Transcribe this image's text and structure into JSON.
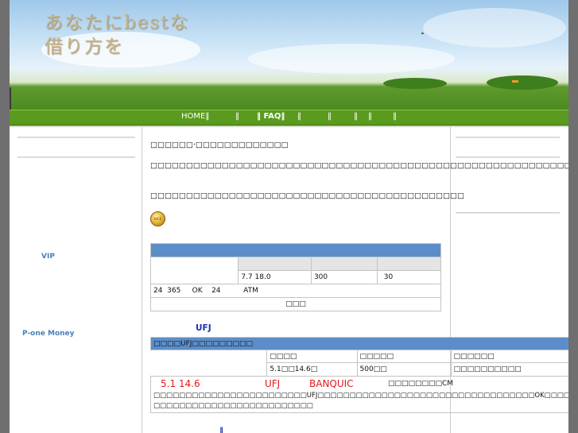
{
  "header": {
    "title": "あなたにbestな\n借り方を"
  },
  "nav": {
    "items": [
      "HOME‖",
      "‖",
      "‖ FAQ‖",
      "‖",
      "‖",
      "‖",
      "‖",
      "‖"
    ]
  },
  "left_sidebar": {
    "link_vip": "VIP",
    "link_pone": "P-one Money"
  },
  "main": {
    "intro_line": "□□□□□□·□□□□□□□□□□□□□",
    "paragraph_1": "□□□□□□□□□□□□□□□□□□□□□□□□□□□□□□□□□□□□□□□□□□□□□□□□□□□□□□□□□□□□□□□□□□□□□□",
    "paragraph_2": "□□□□□□□□□□□□□□□□□□□□□□□□□□□□□□□□□□□□□□□□□□□□",
    "coin_label": "NICE",
    "table1": {
      "rate": "7.7  18.0",
      "limit": "300",
      "days": "30",
      "note_row": "24  365     OK    24          ATM",
      "footer": "□□□"
    },
    "ufj_label": "UFJ",
    "table2": {
      "header": "□□□□UFJ□□□□□□□□□",
      "col_headers": [
        "□□□□",
        "□□□□□",
        "□□□□□□"
      ],
      "values": [
        "5.1□□14.6□",
        "500□□",
        "□□□□□□□□□□"
      ],
      "highlight": [
        "5.1  14.6",
        "UFJ",
        "BANQUIC"
      ],
      "cm_text": "□□□□□□□□CM",
      "body_line_1": "□□□□□□□□□□□□□□□□□□□□□□□□UFJ□□□□□□□□□□□□□□□□□□□□□□□□□□□□□□□□□□OK□□□□",
      "body_line_2": "□□□□□□□□□□□□□□□□□□□□□□□□□"
    },
    "bottom_marker": "‖"
  }
}
